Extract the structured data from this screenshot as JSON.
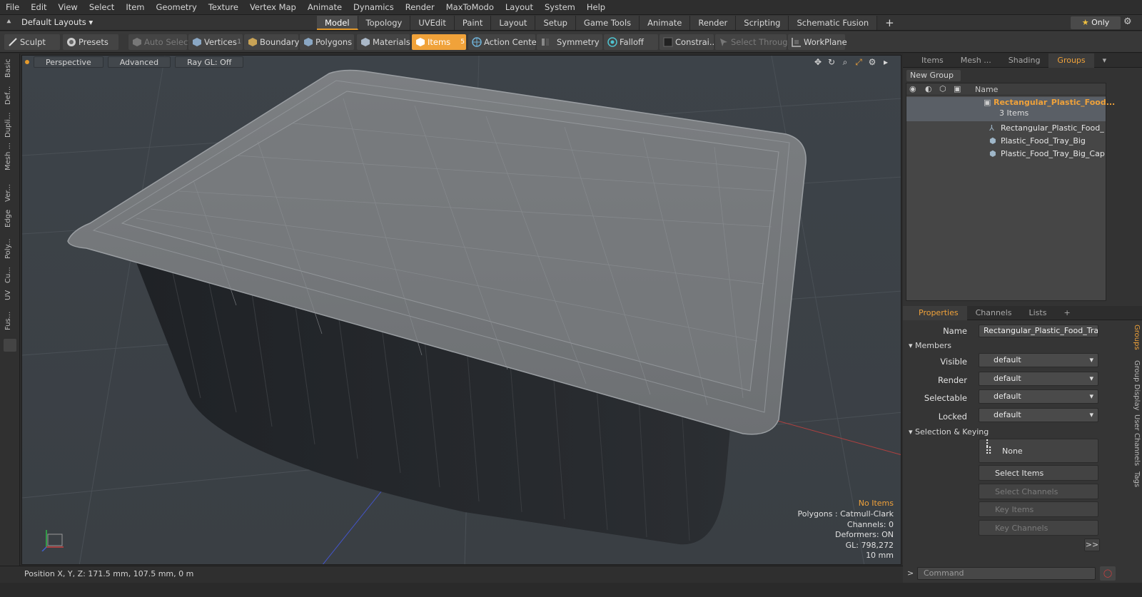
{
  "menu": [
    "File",
    "Edit",
    "View",
    "Select",
    "Item",
    "Geometry",
    "Texture",
    "Vertex Map",
    "Animate",
    "Dynamics",
    "Render",
    "MaxToModo",
    "Layout",
    "System",
    "Help"
  ],
  "layout_selector": "Default Layouts",
  "layout_tabs": [
    "Model",
    "Topology",
    "UVEdit",
    "Paint",
    "Layout",
    "Setup",
    "Game Tools",
    "Animate",
    "Render",
    "Scripting",
    "Schematic Fusion"
  ],
  "active_layout_tab": "Model",
  "only_button": "Only",
  "toolbar": {
    "sculpt": "Sculpt",
    "presets": "Presets",
    "auto_select": "Auto Select",
    "vertices": "Vertices",
    "vertices_count": "1",
    "boundary": "Boundary",
    "polygons": "Polygons",
    "materials": "Materials",
    "items": "Items",
    "items_count": "5",
    "action_center": "Action Center",
    "symmetry": "Symmetry",
    "falloff": "Falloff",
    "constraints": "Constrai...",
    "select_through": "Select Through",
    "workplane": "WorkPlane"
  },
  "left_tabs": [
    "Basic",
    "Def...",
    "Dupli...",
    "Mesh ...",
    "Ver...",
    "Edge",
    "Poly...",
    "Cu...",
    "UV",
    "Fus..."
  ],
  "viewport": {
    "view": "Perspective",
    "shading": "Advanced",
    "raygl": "Ray GL: Off",
    "stats": {
      "no_items": "No Items",
      "polygons": "Polygons : Catmull-Clark",
      "channels": "Channels: 0",
      "deformers": "Deformers: ON",
      "gl": "GL: 798,272",
      "scale": "10 mm"
    }
  },
  "status": "Position X, Y, Z:   171.5 mm, 107.5 mm, 0 m",
  "panel_tabs": [
    "Items",
    "Mesh ...",
    "Shading",
    "Groups"
  ],
  "active_panel_tab": "Groups",
  "new_group": "New Group",
  "outliner": {
    "name_header": "Name",
    "group_name": "Rectangular_Plastic_Food...",
    "group_count": "3 Items",
    "children": [
      "Rectangular_Plastic_Food_ ...",
      "Plastic_Food_Tray_Big",
      "Plastic_Food_Tray_Big_Cap"
    ]
  },
  "props_tabs": [
    "Properties",
    "Channels",
    "Lists"
  ],
  "props": {
    "name_label": "Name",
    "name_value": "Rectangular_Plastic_Food_Tray_w",
    "members": "Members",
    "visible_label": "Visible",
    "render_label": "Render",
    "selectable_label": "Selectable",
    "locked_label": "Locked",
    "dropdown_value": "default",
    "selection_keying": "Selection & Keying",
    "none": "None",
    "select_items": "Select Items",
    "select_channels": "Select Channels",
    "key_items": "Key Items",
    "key_channels": "Key Channels",
    "more": ">>"
  },
  "side_tabs": [
    "Groups",
    "Group Display",
    "User Channels",
    "Tags"
  ],
  "command_placeholder": "Command",
  "colors": {
    "accent": "#f0a23a",
    "viewport_bg": "#3c4248"
  }
}
